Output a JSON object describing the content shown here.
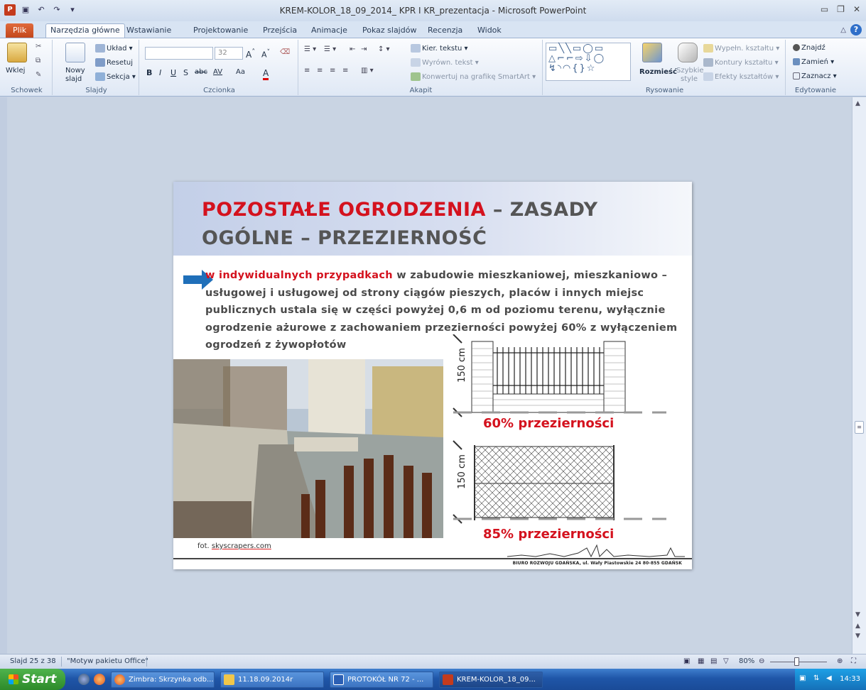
{
  "window": {
    "title": "KREM-KOLOR_18_09_2014_ KPR I KR_prezentacja - Microsoft PowerPoint",
    "quick_access": [
      "save-icon",
      "undo-icon",
      "redo-icon",
      "customize-icon"
    ]
  },
  "tabs": [
    "Plik",
    "Narzędzia główne",
    "Wstawianie",
    "Projektowanie",
    "Przejścia",
    "Animacje",
    "Pokaz slajdów",
    "Recenzja",
    "Widok"
  ],
  "ribbon": {
    "clipboard": {
      "paste": "Wklej",
      "label": "Schowek"
    },
    "slides": {
      "new_slide_1": "Nowy",
      "new_slide_2": "slajd",
      "layout": "Układ",
      "reset": "Resetuj",
      "section": "Sekcja",
      "label": "Slajdy"
    },
    "font": {
      "font_name": "",
      "font_size": "32",
      "bold": "B",
      "italic": "I",
      "underline": "U",
      "strike": "S",
      "abc": "abc",
      "spacing": "AV",
      "case": "Aa",
      "color": "A",
      "label": "Czcionka"
    },
    "paragraph": {
      "text_direction": "Kier. tekstu",
      "align_text": "Wyrówn. tekst",
      "smartart": "Konwertuj na grafikę SmartArt",
      "label": "Akapit"
    },
    "drawing": {
      "arrange": "Rozmieść",
      "quick_styles_1": "Szybkie",
      "quick_styles_2": "style",
      "fill": "Wypełn. kształtu",
      "outline": "Kontury kształtu",
      "effects": "Efekty kształtów",
      "label": "Rysowanie"
    },
    "editing": {
      "find": "Znajdź",
      "replace": "Zamień",
      "select": "Zaznacz",
      "label": "Edytowanie"
    }
  },
  "slide": {
    "title_red": "POZOSTAŁE OGRODZENIA",
    "title_rest": " – ZASADY OGÓLNE – PRZEZIERNOŚĆ",
    "body_red": "w indywidualnych przypadkach",
    "body_rest": " w zabudowie mieszkaniowej, mieszkaniowo – usługowej i usługowej od strony ciągów pieszych, placów i innych miejsc publicznych ustala się w części powyżej 0,6 m od poziomu terenu, wyłącznie ogrodzenie ażurowe z zachowaniem przezierności powyżej 60% z wyłączeniem ogrodzeń z żywopłotów",
    "diagram_height_1": "150 cm",
    "diagram_height_2": "150 cm",
    "percent_1": "60% przezierności",
    "percent_2": "85% przezierności",
    "photo_credit_prefix": "fot. ",
    "photo_credit_site": "skyscrapers.com",
    "footer": "BIURO ROZWOJU GDAŃSKA, ul. Wały Piastowskie 24  80-855 GDAŃSK"
  },
  "status": {
    "slide_info": "Slajd 25 z 38",
    "theme": "\"Motyw pakietu Office\"",
    "zoom": "80%"
  },
  "taskbar": {
    "start": "Start",
    "tasks": [
      "Zimbra: Skrzynka odb...",
      "11.18.09.2014r",
      "PROTOKÓŁ NR  72 - ...",
      "KREM-KOLOR_18_09..."
    ],
    "clock": "14:33"
  },
  "colors": {
    "accent_red": "#d4121e",
    "file_tab": "#c3471b",
    "taskbar": "#1f56a8"
  }
}
